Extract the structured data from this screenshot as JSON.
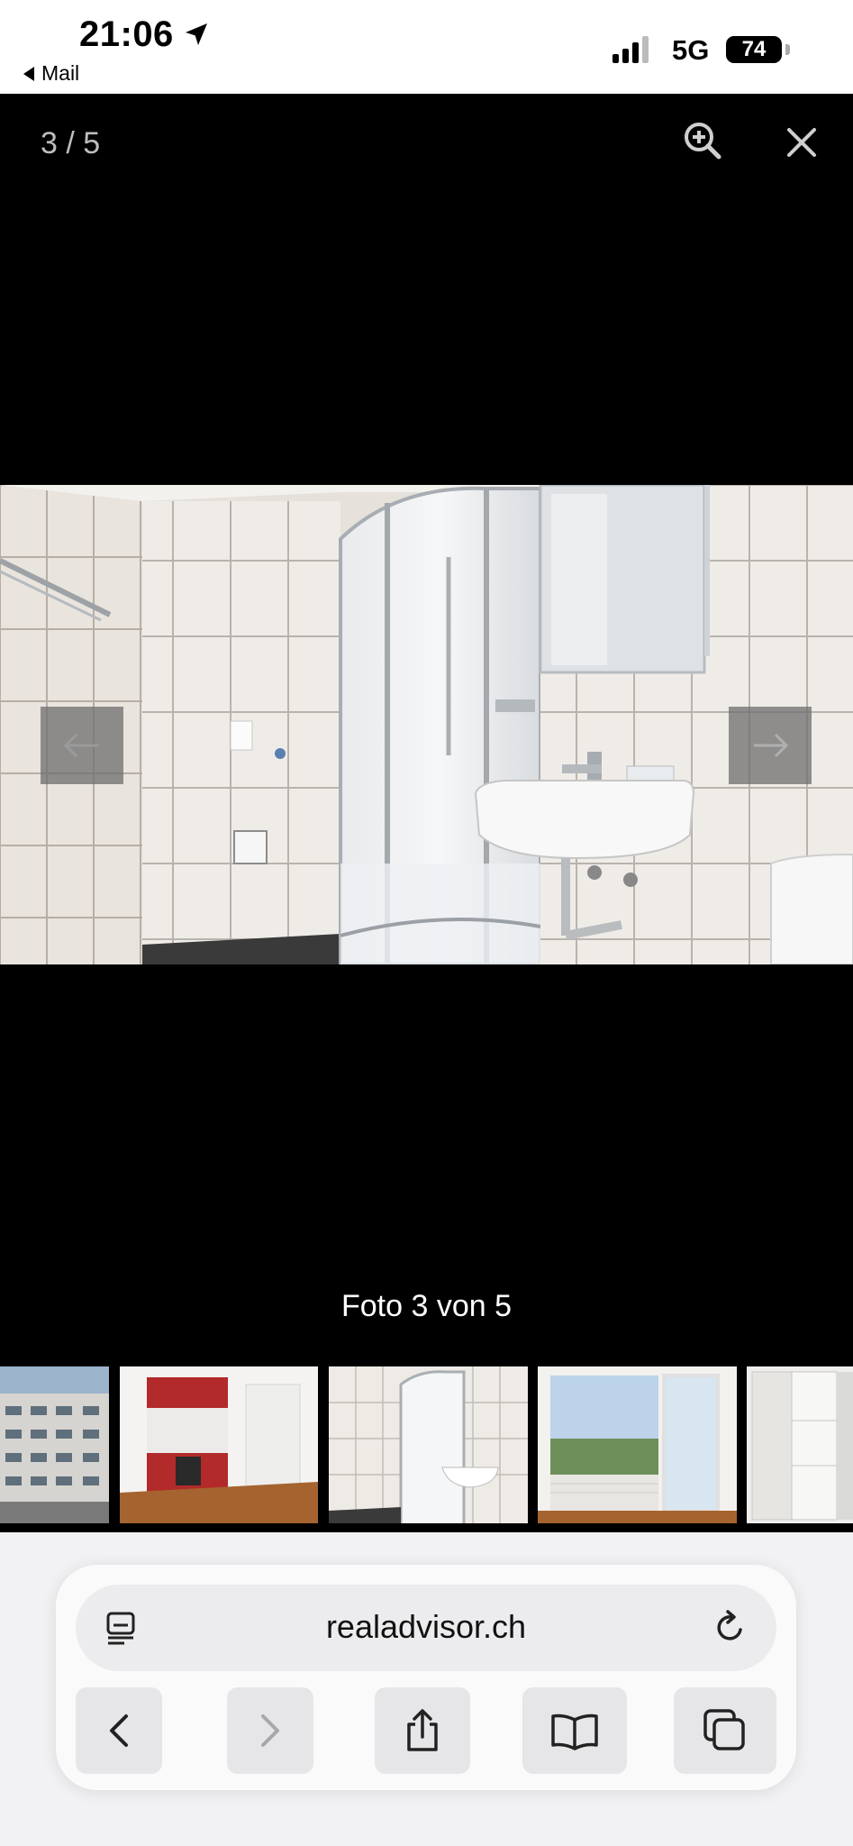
{
  "status_bar": {
    "time": "21:06",
    "back_app": "Mail",
    "network": "5G",
    "battery": "74"
  },
  "viewer": {
    "counter": "3 / 5",
    "caption": "Foto 3 von 5",
    "zoom_icon": "zoom-in-icon",
    "close_icon": "close-icon",
    "prev_icon": "arrow-left-icon",
    "next_icon": "arrow-right-icon",
    "thumbnails": [
      "building-exterior",
      "kitchen",
      "bathroom",
      "window-view",
      "closet"
    ]
  },
  "browser": {
    "url": "realadvisor.ch",
    "toolbar": [
      "back-icon",
      "forward-icon",
      "share-icon",
      "bookmarks-icon",
      "tabs-icon"
    ]
  },
  "colors": {
    "viewer_bg": "#000000",
    "nav_arrow_bg": "#6e6e6e",
    "browser_bg": "#f2f2f4"
  }
}
